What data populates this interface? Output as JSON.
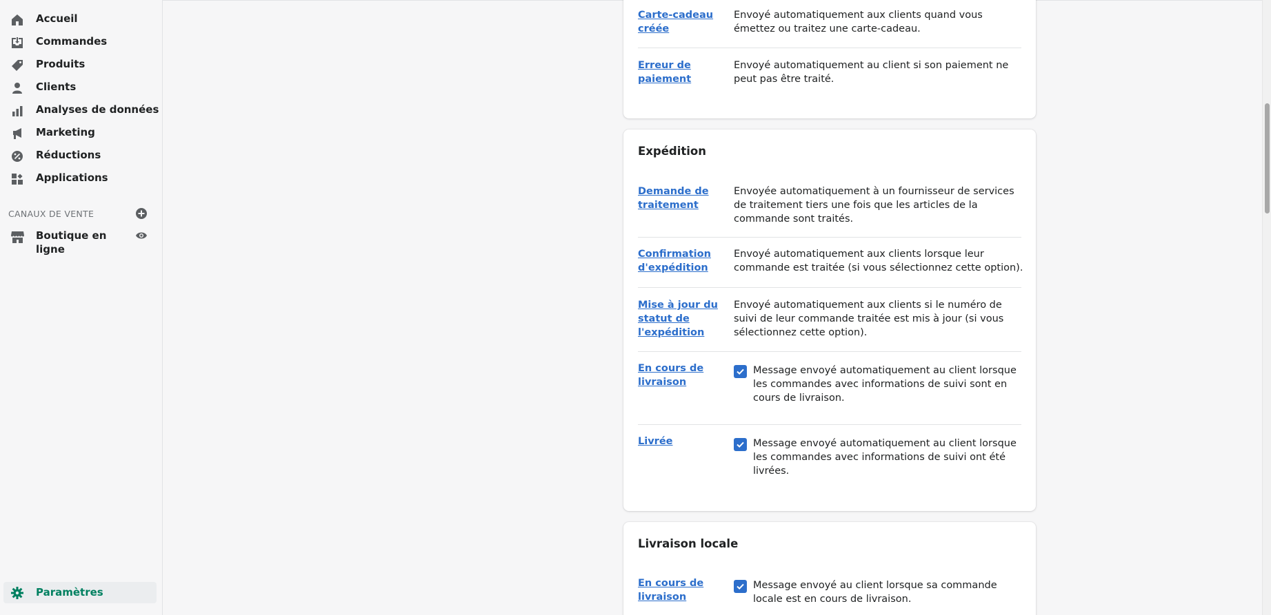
{
  "sidebar": {
    "items": [
      {
        "label": "Accueil",
        "icon": "home-icon"
      },
      {
        "label": "Commandes",
        "icon": "orders-icon"
      },
      {
        "label": "Produits",
        "icon": "tag-icon"
      },
      {
        "label": "Clients",
        "icon": "person-icon"
      },
      {
        "label": "Analyses de données",
        "icon": "bar-chart-icon"
      },
      {
        "label": "Marketing",
        "icon": "megaphone-icon"
      },
      {
        "label": "Réductions",
        "icon": "discount-icon"
      },
      {
        "label": "Applications",
        "icon": "apps-icon"
      }
    ],
    "sales_channels_title": "CANAUX DE VENTE",
    "store_label": "Boutique en ligne",
    "settings_label": "Paramètres"
  },
  "cards": {
    "general": {
      "rows": [
        {
          "link": "Carte-cadeau créée",
          "desc": "Envoyé automatiquement aux clients quand vous émettez ou traitez une carte-cadeau."
        },
        {
          "link": "Erreur de paiement",
          "desc": "Envoyé automatiquement au client si son paiement ne peut pas être traité."
        }
      ]
    },
    "shipping": {
      "title": "Expédition",
      "rows": [
        {
          "link": "Demande de traitement",
          "desc": "Envoyée automatiquement à un fournisseur de services de traitement tiers une fois que les articles de la commande sont traités."
        },
        {
          "link": "Confirmation d'expédition",
          "desc": "Envoyé automatiquement aux clients lorsque leur commande est traitée (si vous sélectionnez cette option)."
        },
        {
          "link": "Mise à jour du statut de l'expédition",
          "desc": "Envoyé automatiquement aux clients si le numéro de suivi de leur commande traitée est mis à jour (si vous sélectionnez cette option)."
        },
        {
          "link": "En cours de livraison",
          "desc": "Message envoyé automatiquement au client lorsque les commandes avec informations de suivi sont en cours de livraison.",
          "checked": true
        },
        {
          "link": "Livrée",
          "desc": "Message envoyé automatiquement au client lorsque les commandes avec informations de suivi ont été livrées.",
          "checked": true
        }
      ]
    },
    "local_delivery": {
      "title": "Livraison locale",
      "rows": [
        {
          "link": "En cours de livraison",
          "desc": "Message envoyé au client lorsque sa commande locale est en cours de livraison.",
          "checked": true
        }
      ]
    }
  },
  "colors": {
    "accent": "#2c6ecb",
    "settings_active": "#008060"
  }
}
